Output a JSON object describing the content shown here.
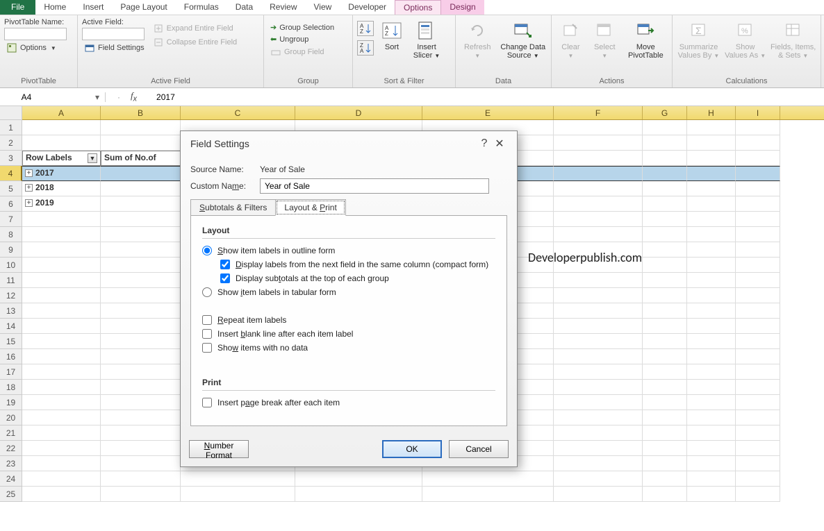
{
  "ribbon_tabs": {
    "file": "File",
    "home": "Home",
    "insert": "Insert",
    "page_layout": "Page Layout",
    "formulas": "Formulas",
    "data": "Data",
    "review": "Review",
    "view": "View",
    "developer": "Developer",
    "options": "Options",
    "design": "Design"
  },
  "ribbon": {
    "pivot_name_label": "PivotTable Name:",
    "options_btn": "Options",
    "pivot_group": "PivotTable",
    "active_field_label": "Active Field:",
    "field_settings": "Field Settings",
    "expand_entire": "Expand Entire Field",
    "collapse_entire": "Collapse Entire Field",
    "active_field_group": "Active Field",
    "group_selection": "Group Selection",
    "ungroup": "Ungroup",
    "group_field": "Group Field",
    "group_group": "Group",
    "sort": "Sort",
    "insert_slicer": "Insert Slicer",
    "sort_filter_group": "Sort & Filter",
    "refresh": "Refresh",
    "change_source": "Change Data Source",
    "data_group": "Data",
    "clear": "Clear",
    "select": "Select",
    "move_pivot": "Move PivotTable",
    "actions_group": "Actions",
    "summarize": "Summarize Values By",
    "show_as": "Show Values As",
    "fields_items": "Fields, Items, & Sets",
    "calc_group": "Calculations"
  },
  "name_box": "A4",
  "formula_value": "2017",
  "columns": [
    "A",
    "B",
    "C",
    "D",
    "E",
    "F",
    "G",
    "H",
    "I"
  ],
  "rows_shown": 25,
  "pivot": {
    "row_labels": "Row Labels",
    "sum_header": "Sum of No.of ",
    "items": [
      "2017",
      "2018",
      "2019"
    ]
  },
  "watermark": "Developerpublish.com",
  "dialog": {
    "title": "Field Settings",
    "source_label": "Source Name:",
    "source_value": "Year of Sale",
    "custom_label": "Custom Name:",
    "custom_value": "Year of Sale",
    "tab1": "Subtotals & Filters",
    "tab2": "Layout & Print",
    "layout_h": "Layout",
    "opt_outline": "Show item labels in outline form",
    "opt_display_next": "Display labels from the next field in the same column (compact form)",
    "opt_subtotals_top": "Display subtotals at the top of each group",
    "opt_tabular": "Show item labels in tabular form",
    "opt_repeat": "Repeat item labels",
    "opt_blank": "Insert blank line after each item label",
    "opt_nodata": "Show items with no data",
    "print_h": "Print",
    "opt_pagebreak": "Insert page break after each item",
    "number_format": "Number Format",
    "ok": "OK",
    "cancel": "Cancel",
    "help": "?",
    "close": "✕"
  }
}
